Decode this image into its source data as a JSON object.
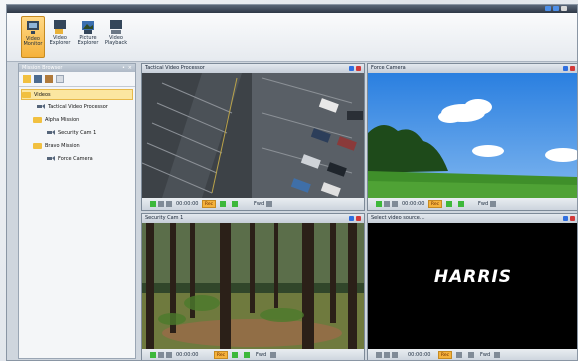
{
  "ribbon": {
    "buttons": [
      {
        "label_1": "Video",
        "label_2": "Monitor"
      },
      {
        "label_1": "Video",
        "label_2": "Explorer"
      },
      {
        "label_1": "Picture",
        "label_2": "Explorer"
      },
      {
        "label_1": "Video",
        "label_2": "Playback"
      }
    ]
  },
  "mission_browser": {
    "title": "Mission Browser",
    "tree": [
      {
        "label": "Videos"
      },
      {
        "label": "Tactical Video Processor"
      },
      {
        "label": "Alpha Mission"
      },
      {
        "label": "Security Cam 1"
      },
      {
        "label": "Bravo Mission"
      },
      {
        "label": "Force Camera"
      }
    ]
  },
  "panes": [
    {
      "title": "Tactical Video Processor",
      "time": "00:00:00",
      "rec": "Rec",
      "fwd": "Fwd"
    },
    {
      "title": "Force Camera",
      "time": "00:00:00",
      "rec": "Rec",
      "fwd": "Fwd"
    },
    {
      "title": "Security Cam 1",
      "time": "00:00:00",
      "rec": "Rec",
      "fwd": "Fwd"
    },
    {
      "title": "Select video source...",
      "time": "00:00:00",
      "rec": "Rec",
      "fwd": "Fwd",
      "logo": "HARRIS"
    }
  ],
  "colors": {
    "accent": "#f5b23b",
    "status_green": "#3db83a",
    "status_blue": "#2f6fe0",
    "status_red": "#d23a3a"
  }
}
